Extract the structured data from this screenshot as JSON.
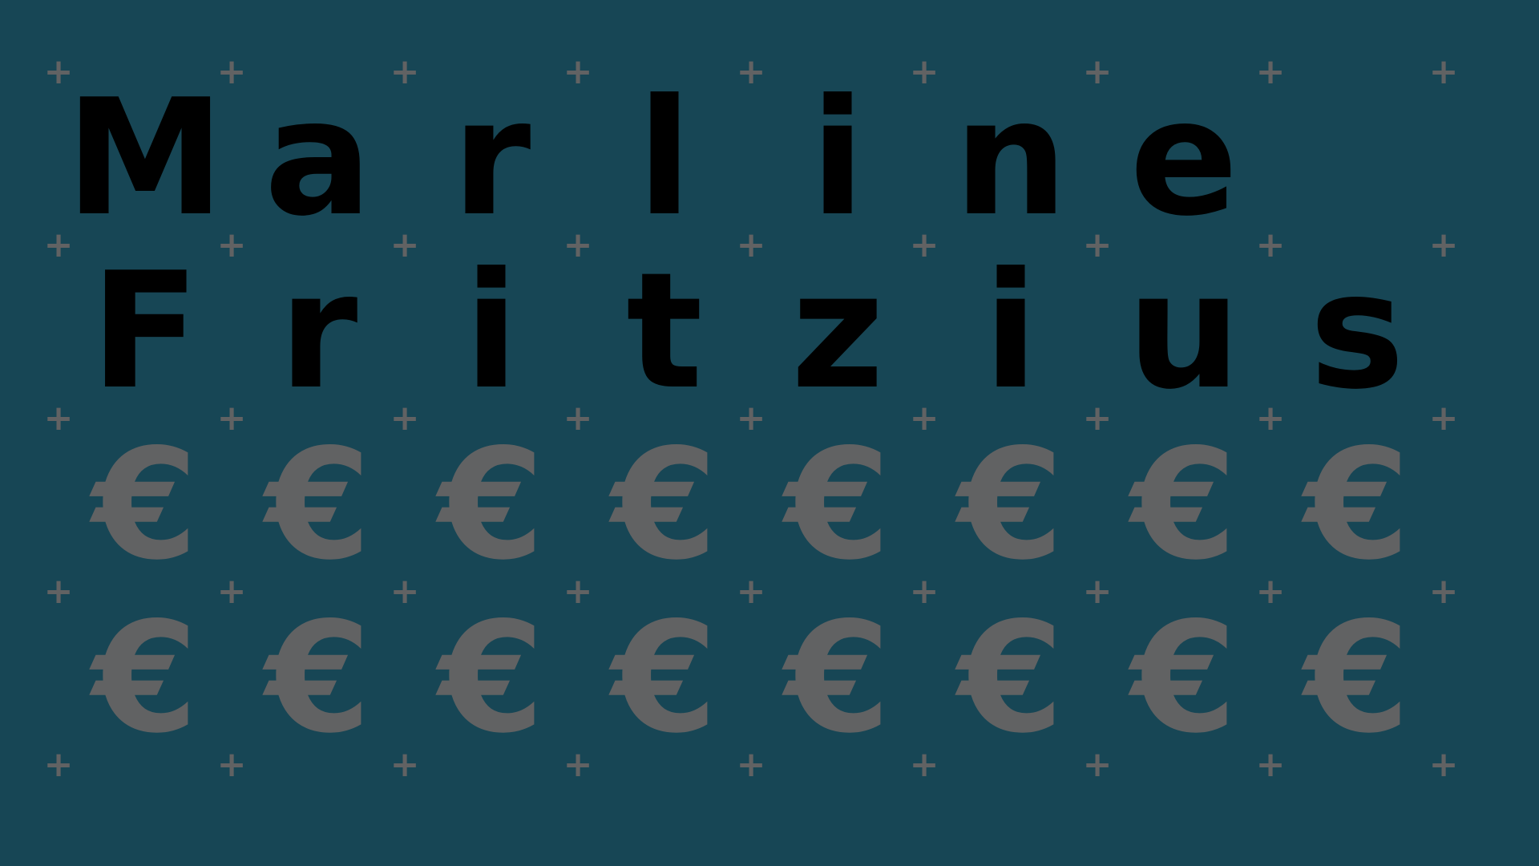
{
  "colors": {
    "background": "#174655",
    "letter": "#000000",
    "symbol": "#616263"
  },
  "grid_marker": "+",
  "rows": [
    {
      "name": "first-name",
      "chars": [
        "M",
        "a",
        "r",
        "l",
        "i",
        "n",
        "e",
        ""
      ]
    },
    {
      "name": "last-name",
      "chars": [
        "F",
        "r",
        "i",
        "t",
        "z",
        "i",
        "u",
        "s"
      ]
    },
    {
      "name": "euro-row-1",
      "chars": [
        "€",
        "€",
        "€",
        "€",
        "€",
        "€",
        "€",
        "€"
      ]
    },
    {
      "name": "euro-row-2",
      "chars": [
        "€",
        "€",
        "€",
        "€",
        "€",
        "€",
        "€",
        "€"
      ]
    }
  ]
}
